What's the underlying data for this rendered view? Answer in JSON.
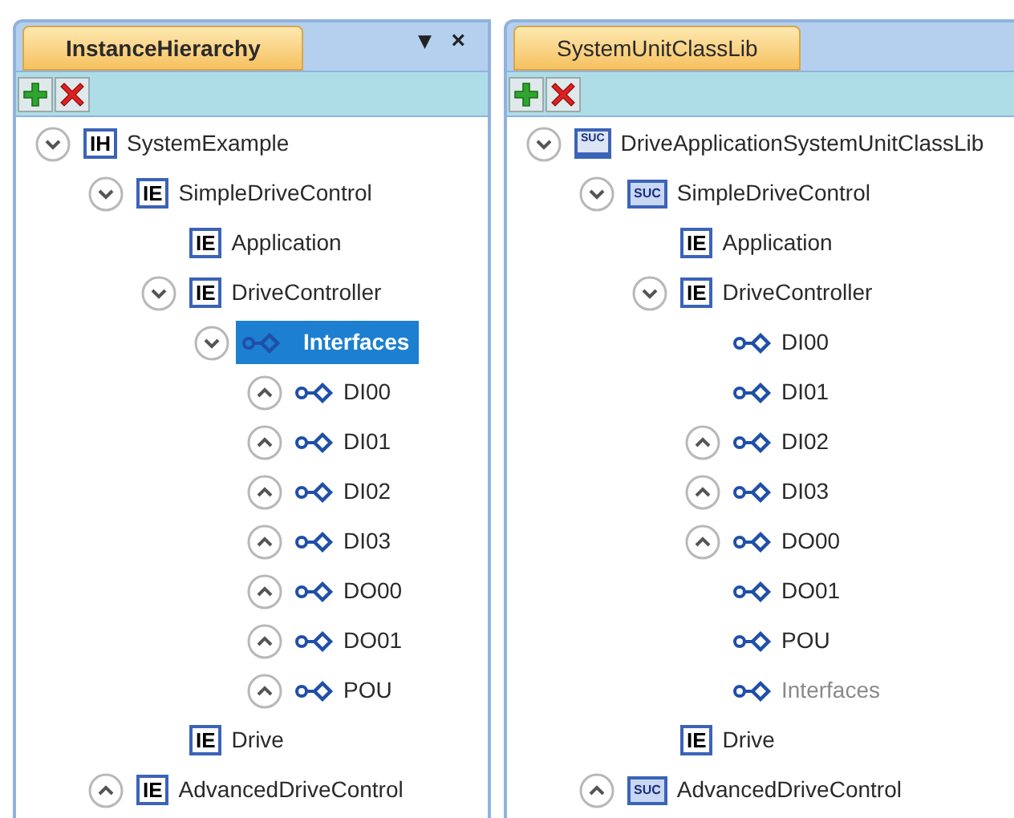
{
  "panels": [
    {
      "tab": {
        "label": "InstanceHierarchy",
        "bold": true
      },
      "pane_buttons": [
        "▾",
        "×"
      ],
      "tree": [
        {
          "label": "SystemExample",
          "kind": "element",
          "badge": "IH",
          "expanded": true,
          "selected": false,
          "children": [
            {
              "label": "SimpleDriveControl",
              "kind": "element",
              "badge": "IE",
              "expanded": true,
              "selected": false,
              "children": [
                {
                  "label": "Application",
                  "kind": "element",
                  "badge": "IE",
                  "selected": false
                },
                {
                  "label": "DriveController",
                  "kind": "element",
                  "badge": "IE",
                  "expanded": true,
                  "selected": false,
                  "children": [
                    {
                      "label": "Interfaces",
                      "kind": "interface",
                      "expanded": true,
                      "selected": true,
                      "children": [
                        {
                          "label": "DI00",
                          "kind": "interface",
                          "expanded": false,
                          "selected": false
                        },
                        {
                          "label": "DI01",
                          "kind": "interface",
                          "expanded": false,
                          "selected": false
                        },
                        {
                          "label": "DI02",
                          "kind": "interface",
                          "expanded": false,
                          "selected": false
                        },
                        {
                          "label": "DI03",
                          "kind": "interface",
                          "expanded": false,
                          "selected": false
                        },
                        {
                          "label": "DO00",
                          "kind": "interface",
                          "expanded": false,
                          "selected": false
                        },
                        {
                          "label": "DO01",
                          "kind": "interface",
                          "expanded": false,
                          "selected": false
                        },
                        {
                          "label": "POU",
                          "kind": "interface",
                          "expanded": false,
                          "selected": false
                        }
                      ]
                    }
                  ]
                },
                {
                  "label": "Drive",
                  "kind": "element",
                  "badge": "IE",
                  "selected": false
                }
              ]
            },
            {
              "label": "AdvancedDriveControl",
              "kind": "element",
              "badge": "IE",
              "expanded": false,
              "selected": false
            }
          ]
        }
      ]
    },
    {
      "tab": {
        "label": "SystemUnitClassLib",
        "bold": false
      },
      "tree": [
        {
          "label": "DriveApplicationSystemUnitClassLib",
          "kind": "library",
          "badge": "SUC",
          "expanded": true,
          "selected": false,
          "children": [
            {
              "label": "SimpleDriveControl",
              "kind": "class",
              "badge": "SUC",
              "expanded": true,
              "selected": false,
              "children": [
                {
                  "label": "Application",
                  "kind": "element",
                  "badge": "IE",
                  "selected": false
                },
                {
                  "label": "DriveController",
                  "kind": "element",
                  "badge": "IE",
                  "expanded": true,
                  "selected": false,
                  "children": [
                    {
                      "label": "DI00",
                      "kind": "interface",
                      "selected": false
                    },
                    {
                      "label": "DI01",
                      "kind": "interface",
                      "selected": false
                    },
                    {
                      "label": "DI02",
                      "kind": "interface",
                      "expanded": false,
                      "selected": false
                    },
                    {
                      "label": "DI03",
                      "kind": "interface",
                      "expanded": false,
                      "selected": false
                    },
                    {
                      "label": "DO00",
                      "kind": "interface",
                      "expanded": false,
                      "selected": false
                    },
                    {
                      "label": "DO01",
                      "kind": "interface",
                      "selected": false
                    },
                    {
                      "label": "POU",
                      "kind": "interface",
                      "selected": false
                    },
                    {
                      "label": "Interfaces",
                      "kind": "interface",
                      "dimmed": true,
                      "selected": false
                    }
                  ]
                },
                {
                  "label": "Drive",
                  "kind": "element",
                  "badge": "IE",
                  "selected": false
                }
              ]
            },
            {
              "label": "AdvancedDriveControl",
              "kind": "class",
              "badge": "SUC",
              "expanded": false,
              "selected": false
            }
          ]
        }
      ]
    }
  ]
}
